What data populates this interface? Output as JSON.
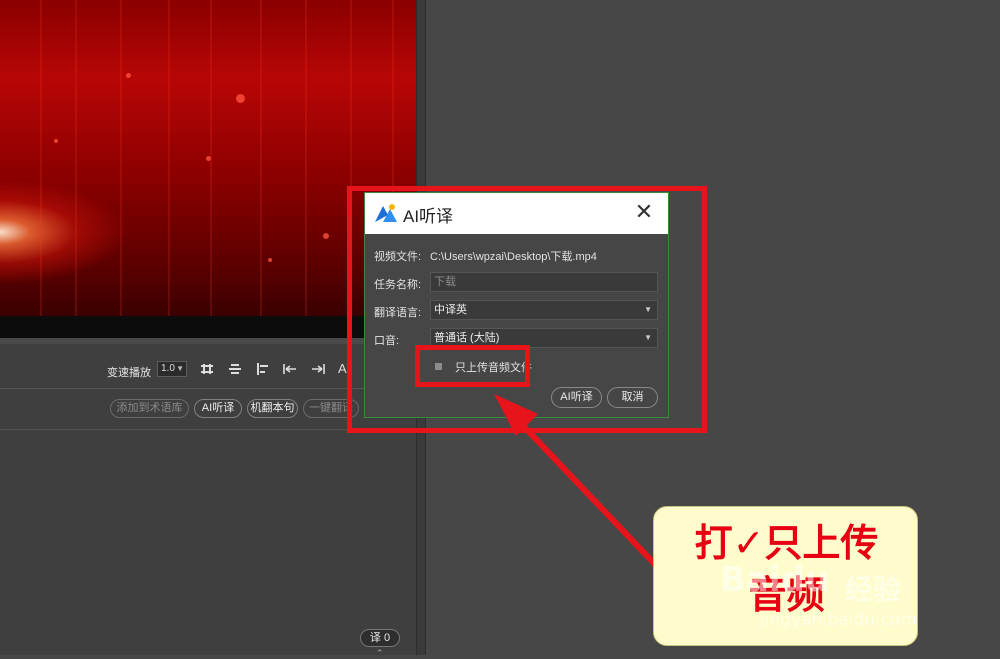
{
  "toolbar": {
    "speed_label": "变速播放",
    "speed_value": "1.0",
    "font_glyph": "A"
  },
  "action_pills": [
    "添加到术语库",
    "AI听译",
    "机翻本句",
    "一键翻译"
  ],
  "translate_count": "译 0",
  "dialog": {
    "title": "AI听译",
    "close_glyph": "✕",
    "video_file_label": "视频文件:",
    "video_file_path": "C:\\Users\\wpzai\\Desktop\\下载.mp4",
    "task_name_label": "任务名称:",
    "task_name_placeholder": "下载",
    "language_label": "翻译语言:",
    "language_value": "中译英",
    "accent_label": "口音:",
    "accent_value": "普通话 (大陆)",
    "audio_only_label": "只上传音频文件",
    "audio_only_checked": false,
    "confirm_button": "AI听译",
    "cancel_button": "取消"
  },
  "annotation": {
    "callout_line1": "打✓只上传",
    "callout_line2": "音频",
    "highlight_color": "#e8141b",
    "callout_bg": "#fefccc"
  },
  "watermark": {
    "brand": "Baidu",
    "jingyan": "经验",
    "url": "jingyan.baidu.com"
  }
}
